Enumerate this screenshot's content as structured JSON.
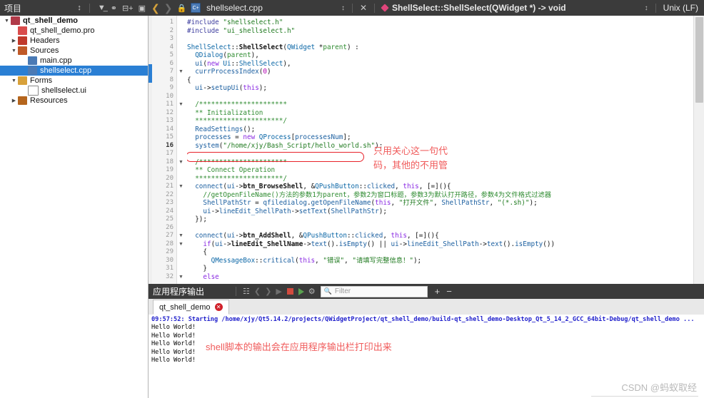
{
  "topbar": {
    "project_label": "项目",
    "filter_icon": "filter-icon",
    "link_icon": "link-icon",
    "split_icon": "split-add-icon",
    "panel_icon": "panel-icon",
    "back_icon": "nav-back-icon",
    "forward_icon": "nav-forward-icon",
    "lock_icon": "lock-icon",
    "file_icon_text": "C+",
    "file_name": "shellselect.cpp",
    "close_icon": "close-icon",
    "symbol_marker": "function-marker-icon",
    "symbol_text": "ShellSelect::ShellSelect(QWidget *) -> void",
    "eol_label": "Unix (LF)",
    "dropdown_icon": "chevron-updown-icon"
  },
  "tree": {
    "items": [
      {
        "label": "qt_shell_demo",
        "indent": 0,
        "arrow": "open",
        "icon": "project-icon",
        "bold": true,
        "selected": false
      },
      {
        "label": "qt_shell_demo.pro",
        "indent": 1,
        "arrow": "none",
        "icon": "pro-file-icon",
        "bold": false,
        "selected": false
      },
      {
        "label": "Headers",
        "indent": 1,
        "arrow": "closed",
        "icon": "headers-icon",
        "bold": false,
        "selected": false
      },
      {
        "label": "Sources",
        "indent": 1,
        "arrow": "open",
        "icon": "sources-icon",
        "bold": false,
        "selected": false
      },
      {
        "label": "main.cpp",
        "indent": 2,
        "arrow": "none",
        "icon": "cpp-file-icon",
        "bold": false,
        "selected": false
      },
      {
        "label": "shellselect.cpp",
        "indent": 2,
        "arrow": "none",
        "icon": "cpp-file-icon",
        "bold": false,
        "selected": true
      },
      {
        "label": "Forms",
        "indent": 1,
        "arrow": "open",
        "icon": "forms-icon",
        "bold": false,
        "selected": false
      },
      {
        "label": "shellselect.ui",
        "indent": 2,
        "arrow": "none",
        "icon": "ui-file-icon",
        "bold": false,
        "selected": false
      },
      {
        "label": "Resources",
        "indent": 1,
        "arrow": "closed",
        "icon": "resources-icon",
        "bold": false,
        "selected": false
      }
    ]
  },
  "editor": {
    "current_line": 16,
    "fold_lines": [
      7,
      11,
      18,
      21,
      27,
      28,
      32
    ],
    "lines": [
      {
        "n": 1,
        "html": "<span class='pp'>#include</span> <span class='st'>\"shellselect.h\"</span>"
      },
      {
        "n": 2,
        "html": "<span class='pp'>#include</span> <span class='st'>\"ui_shellselect.h\"</span>"
      },
      {
        "n": 3,
        "html": ""
      },
      {
        "n": 4,
        "html": "<span class='ty'>ShellSelect</span>::<span class='bd'>ShellSelect</span>(<span class='ty'>QWidget</span> *<span class='cm'>parent</span>) :"
      },
      {
        "n": 5,
        "html": "  <span class='ty'>QDialog</span>(<span class='cm'>parent</span>),"
      },
      {
        "n": 6,
        "html": "  <span class='fn'>ui</span>(<span class='k'>new</span> <span class='ty'>Ui</span>::<span class='ty'>ShellSelect</span>),"
      },
      {
        "n": 7,
        "html": "  <span class='fn'>currProcessIndex</span>(<span class='num'>0</span>)"
      },
      {
        "n": 8,
        "html": "{"
      },
      {
        "n": 9,
        "html": "  <span class='fn'>ui</span>-&gt;<span class='fn'>setupUi</span>(<span class='k'>this</span>);"
      },
      {
        "n": 10,
        "html": ""
      },
      {
        "n": 11,
        "html": "  <span class='cm'>/**********************</span>"
      },
      {
        "n": 12,
        "html": "  <span class='cm'>** Initialization</span>"
      },
      {
        "n": 13,
        "html": "  <span class='cm'>**********************/</span>"
      },
      {
        "n": 14,
        "html": "  <span class='fn'>ReadSettings</span>();"
      },
      {
        "n": 15,
        "html": "  <span class='fn'>processes</span> = <span class='k'>new</span> <span class='ty'>QProcess</span>[<span class='fn'>processesNum</span>];"
      },
      {
        "n": 16,
        "html": "  <span class='fn'>system</span>(<span class='st'>\"/home/xjy/Bash_Script/hello_world.sh\"</span>);"
      },
      {
        "n": 17,
        "html": ""
      },
      {
        "n": 18,
        "html": "  <span class='cm'>/**********************</span>"
      },
      {
        "n": 19,
        "html": "  <span class='cm'>** Connect Operation</span>"
      },
      {
        "n": 20,
        "html": "  <span class='cm'>**********************/</span>"
      },
      {
        "n": 21,
        "html": "  <span class='fn'>connect</span>(<span class='fn'>ui</span>-&gt;<span class='bd'>btn_BrowseShell</span>, &amp;<span class='ty'>QPushButton</span>::<span class='fn'>clicked</span>, <span class='k'>this</span>, [=](){"
      },
      {
        "n": 22,
        "html": "    <span class='cm'>//getOpenFileName()方法的参数1为parent，参数2为窗口标题，参数3为默认打开路径，参数4为文件格式过滤器</span>"
      },
      {
        "n": 23,
        "html": "    <span class='fn'>ShellPathStr</span> = <span class='fn'>qfiledialog</span>.<span class='fn'>getOpenFileName</span>(<span class='k'>this</span>, <span class='st'>\"打开文件\"</span>, <span class='fn'>ShellPathStr</span>, <span class='st'>\"(*.sh)\"</span>);"
      },
      {
        "n": 24,
        "html": "    <span class='fn'>ui</span>-&gt;<span class='fn'>lineEdit_ShellPath</span>-&gt;<span class='fn'>setText</span>(<span class='fn'>ShellPathStr</span>);"
      },
      {
        "n": 25,
        "html": "  });"
      },
      {
        "n": 26,
        "html": ""
      },
      {
        "n": 27,
        "html": "  <span class='fn'>connect</span>(<span class='fn'>ui</span>-&gt;<span class='bd'>btn_AddShell</span>, &amp;<span class='ty'>QPushButton</span>::<span class='fn'>clicked</span>, <span class='k'>this</span>, [=](){"
      },
      {
        "n": 28,
        "html": "    <span class='k'>if</span>(<span class='fn'>ui</span>-&gt;<span class='bd'>lineEdit_ShellName</span>-&gt;<span class='fn'>text</span>().<span class='fn'>isEmpty</span>() || <span class='fn'>ui</span>-&gt;<span class='fn'>lineEdit_ShellPath</span>-&gt;<span class='fn'>text</span>().<span class='fn'>isEmpty</span>())"
      },
      {
        "n": 29,
        "html": "    {"
      },
      {
        "n": 30,
        "html": "      <span class='ty'>QMessageBox</span>::<span class='fn'>critical</span>(<span class='k'>this</span>, <span class='st'>\"错误\"</span>, <span class='st'>\"请填写完整信息！\"</span>);"
      },
      {
        "n": 31,
        "html": "    }"
      },
      {
        "n": 32,
        "html": "    <span class='k'>else</span>"
      }
    ],
    "annotation_code": {
      "line1": "只用关心这一句代",
      "line2": "码，其他的不用管",
      "color": "#f05b5b"
    },
    "highlight_box_color": "#e8222a"
  },
  "output_panel": {
    "title": "应用程序输出",
    "icons": [
      "select-all-icon",
      "prev-icon",
      "next-icon",
      "run-icon",
      "stop-icon",
      "run-with-icon",
      "settings-icon"
    ],
    "filter_placeholder": "Filter",
    "filter_value": "",
    "search_icon": "search-icon",
    "zoom_in_label": "+",
    "zoom_out_label": "−",
    "tab_label": "qt_shell_demo",
    "tab_close_icon": "close-circle-icon",
    "lines": [
      {
        "text": "09:57:52: Starting /home/xjy/Qt5.14.2/projects/QWidgetProject/qt_shell_demo/build-qt_shell_demo-Desktop_Qt_5_14_2_GCC_64bit-Debug/qt_shell_demo ...",
        "style": "blue"
      },
      {
        "text": "Hello World!",
        "style": "plain"
      },
      {
        "text": "Hello World!",
        "style": "plain"
      },
      {
        "text": "Hello World!",
        "style": "plain"
      },
      {
        "text": "Hello World!",
        "style": "plain"
      },
      {
        "text": "Hello World!",
        "style": "plain"
      }
    ],
    "annotation": "shell脚本的输出会在应用程序输出栏打印出来"
  },
  "watermark": "CSDN @蚂蚁取经"
}
